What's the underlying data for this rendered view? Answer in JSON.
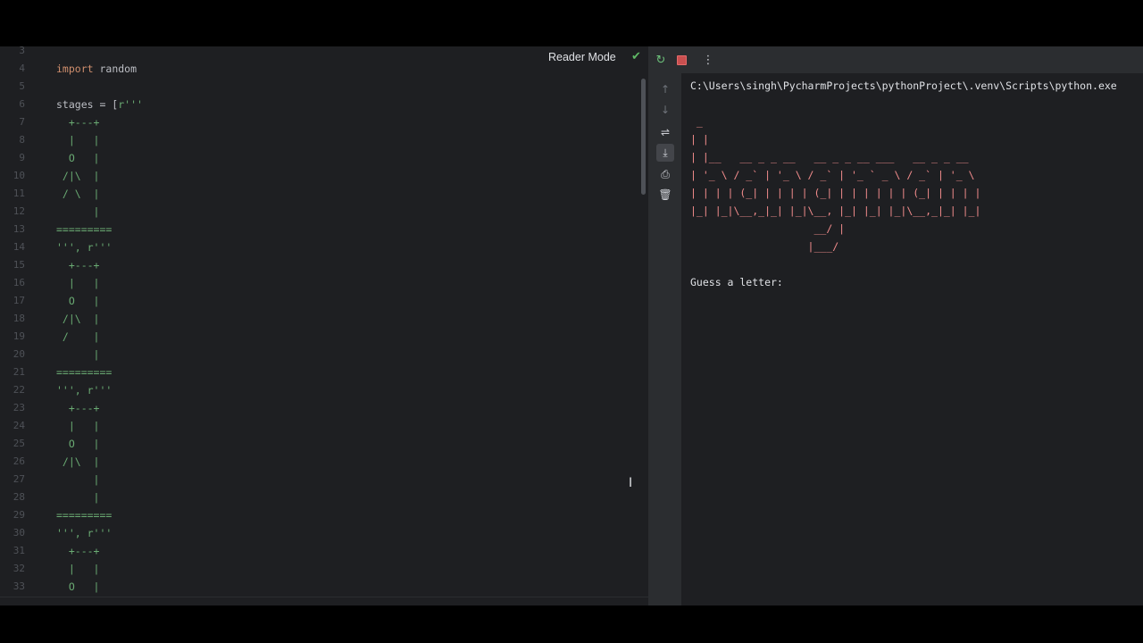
{
  "editor": {
    "reader_mode_label": "Reader Mode",
    "line_numbers": [
      "3",
      "4",
      "5",
      "6",
      "7",
      "8",
      "9",
      "10",
      "11",
      "12",
      "13",
      "14",
      "15",
      "16",
      "17",
      "18",
      "19",
      "20",
      "21",
      "22",
      "23",
      "24",
      "25",
      "26",
      "27",
      "28",
      "29",
      "30",
      "31",
      "32",
      "33"
    ],
    "lines": [
      {
        "text": ""
      },
      {
        "kw": "import",
        "rest": " random"
      },
      {
        "text": ""
      },
      {
        "plain": "stages = [",
        "str": "r'''"
      },
      {
        "str": "  +---+"
      },
      {
        "str": "  |   |"
      },
      {
        "str": "  O   |"
      },
      {
        "str": " /|\\  |"
      },
      {
        "str": " / \\  |"
      },
      {
        "str": "      |"
      },
      {
        "str": "========="
      },
      {
        "str": "''', r'''"
      },
      {
        "str": "  +---+"
      },
      {
        "str": "  |   |"
      },
      {
        "str": "  O   |"
      },
      {
        "str": " /|\\  |"
      },
      {
        "str": " /    |"
      },
      {
        "str": "      |"
      },
      {
        "str": "========="
      },
      {
        "str": "''', r'''"
      },
      {
        "str": "  +---+"
      },
      {
        "str": "  |   |"
      },
      {
        "str": "  O   |"
      },
      {
        "str": " /|\\  |"
      },
      {
        "str": "      |"
      },
      {
        "str": "      |"
      },
      {
        "str": "========="
      },
      {
        "str": "''', r'''"
      },
      {
        "str": "  +---+"
      },
      {
        "str": "  |   |"
      },
      {
        "str": "  O   |"
      }
    ]
  },
  "run": {
    "path": "C:\\Users\\singh\\PycharmProjects\\pythonProject\\.venv\\Scripts\\python.exe",
    "art": " _\n| |\n| |__   __ _ _ __   __ _ _ __ ___   __ _ _ __\n| '_ \\ / _` | '_ \\ / _` | '_ ` _ \\ / _` | '_ \\\n| | | | (_| | | | | (_| | | | | | | (_| | | | |\n|_| |_|\\__,_|_| |_|\\__, |_| |_| |_|\\__,_|_| |_|\n                    __/ |\n                   |___/",
    "prompt": "Guess a letter:"
  },
  "colors": {
    "keyword": "#cf8e6d",
    "string": "#6aab73",
    "art": "#f28c8c",
    "background": "#1e1f22"
  }
}
